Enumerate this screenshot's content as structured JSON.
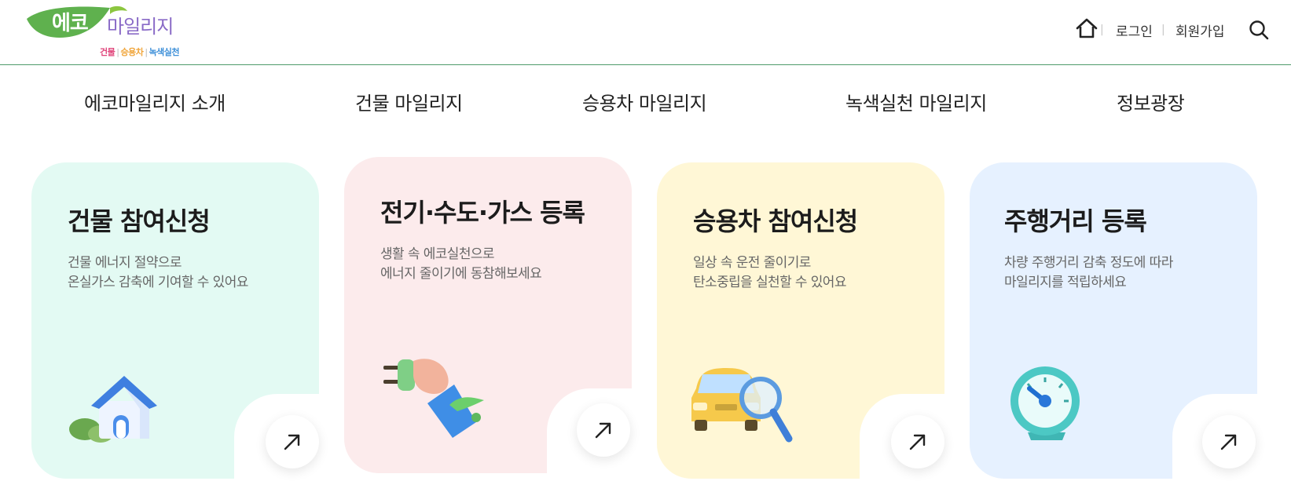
{
  "logo": {
    "main_text": "에코마일리지",
    "sub": [
      "건물",
      "승용차",
      "녹색실천"
    ]
  },
  "util": {
    "login": "로그인",
    "join": "회원가입",
    "icons": {
      "home": "home-icon",
      "search": "search-icon"
    }
  },
  "nav": {
    "items": [
      "에코마일리지 소개",
      "건물 마일리지",
      "승용차 마일리지",
      "녹색실천 마일리지",
      "정보광장"
    ]
  },
  "cards": [
    {
      "title": "건물 참여신청",
      "desc1": "건물 에너지 절약으로",
      "desc2": "온실가스 감축에 기여할 수 있어요",
      "bg": "#e3faf3",
      "icon": "house-icon"
    },
    {
      "title": "전기·수도·가스 등록",
      "desc1": "생활 속 에코실천으로",
      "desc2": "에너지 줄이기에 동참해보세요",
      "bg": "#fcebec",
      "icon": "plug-hand-icon"
    },
    {
      "title": "승용차 참여신청",
      "desc1": "일상 속 운전 줄이기로",
      "desc2": "탄소중립을 실천할 수 있어요",
      "bg": "#fff7d6",
      "icon": "car-magnifier-icon"
    },
    {
      "title": "주행거리 등록",
      "desc1": "차량 주행거리 감축 정도에 따라",
      "desc2": "마일리지를 적립하세요",
      "bg": "#e6f1ff",
      "icon": "gauge-icon"
    }
  ],
  "colors": {
    "header_line": "#4f9b6a",
    "logo_green": "#5fb14e",
    "logo_purple": "#8a6bc7"
  }
}
